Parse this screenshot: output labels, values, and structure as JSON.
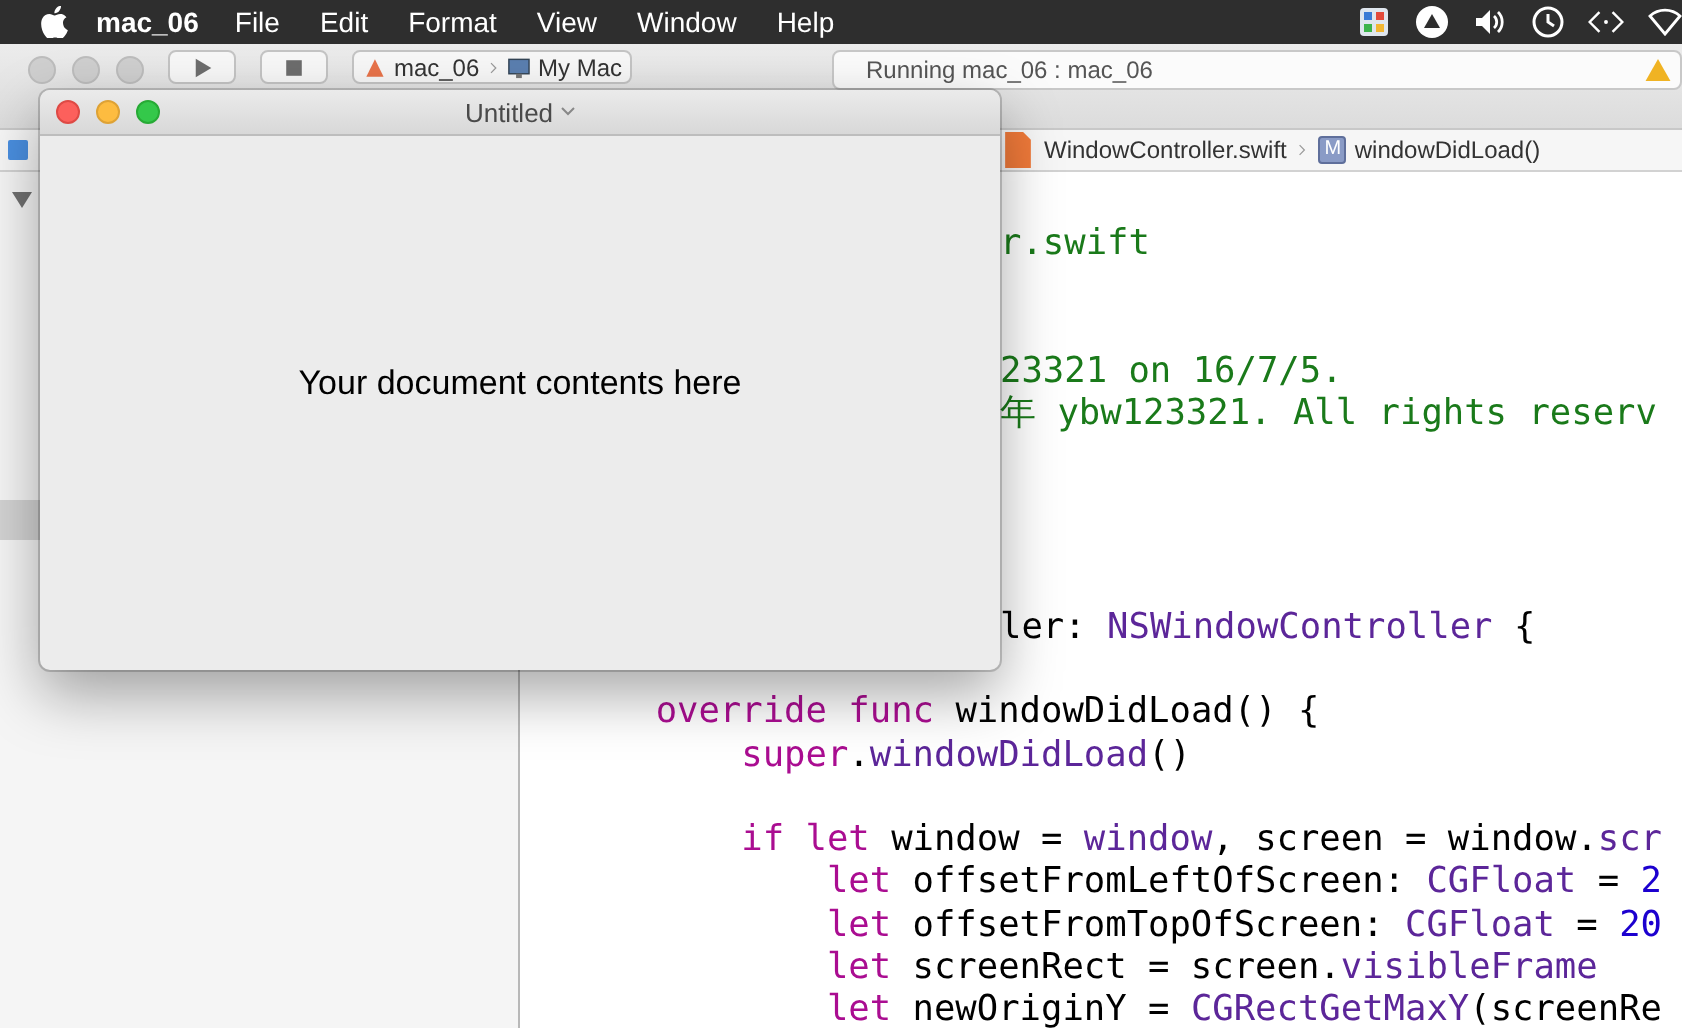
{
  "menu_bar": {
    "app": "mac_06",
    "items": [
      "File",
      "Edit",
      "Format",
      "View",
      "Window",
      "Help"
    ]
  },
  "xcode": {
    "toolbar": {
      "scheme": [
        "mac_06",
        "My Mac"
      ],
      "activity": "Running mac_06 : mac_06"
    },
    "jump_bar": [
      {
        "kind": "file",
        "label": "WindowController.swift"
      },
      {
        "kind": "method",
        "badge": "M",
        "label": "windowDidLoad()"
      }
    ],
    "editor": {
      "lines": [
        {
          "kind": "clipped",
          "segments": [
            {
              "kind": "comment",
              "text": "r.swift"
            }
          ]
        },
        {
          "kind": "blank"
        },
        {
          "kind": "blank"
        },
        {
          "kind": "clipped",
          "segments": [
            {
              "kind": "comment",
              "text": "23321 on 16/7/5."
            }
          ]
        },
        {
          "kind": "clipped",
          "segments": [
            {
              "kind": "comment",
              "text": "年 ybw123321. All rights reserv"
            }
          ]
        },
        {
          "kind": "blank"
        },
        {
          "kind": "blank"
        },
        {
          "kind": "blank"
        },
        {
          "kind": "blank"
        },
        {
          "kind": "clipped",
          "segments": [
            {
              "kind": "plain",
              "text": "ler: "
            },
            {
              "kind": "type",
              "text": "NSWindowController"
            },
            {
              "kind": "plain",
              "text": " {"
            }
          ],
          "children": [
            {
              "kind": "blank"
            },
            {
              "kind": "code",
              "segments": [
                {
                  "kind": "keyword",
                  "text": "override func"
                },
                {
                  "kind": "plain",
                  "text": " windowDidLoad() {"
                }
              ],
              "children": [
                {
                  "kind": "code",
                  "segments": [
                    {
                      "kind": "keyword",
                      "text": "super"
                    },
                    {
                      "kind": "plain",
                      "text": "."
                    },
                    {
                      "kind": "type",
                      "text": "windowDidLoad"
                    },
                    {
                      "kind": "plain",
                      "text": "()"
                    }
                  ]
                },
                {
                  "kind": "blank"
                },
                {
                  "kind": "code",
                  "segments": [
                    {
                      "kind": "keyword",
                      "text": "if let"
                    },
                    {
                      "kind": "plain",
                      "text": " window = "
                    },
                    {
                      "kind": "type",
                      "text": "window"
                    },
                    {
                      "kind": "plain",
                      "text": ", screen = window."
                    },
                    {
                      "kind": "type",
                      "text": "scr"
                    }
                  ],
                  "children": [
                    {
                      "kind": "code",
                      "segments": [
                        {
                          "kind": "keyword",
                          "text": "let"
                        },
                        {
                          "kind": "plain",
                          "text": " offsetFromLeftOfScreen: "
                        },
                        {
                          "kind": "type",
                          "text": "CGFloat"
                        },
                        {
                          "kind": "plain",
                          "text": " = "
                        },
                        {
                          "kind": "number",
                          "text": "2"
                        }
                      ]
                    },
                    {
                      "kind": "code",
                      "segments": [
                        {
                          "kind": "keyword",
                          "text": "let"
                        },
                        {
                          "kind": "plain",
                          "text": " offsetFromTopOfScreen: "
                        },
                        {
                          "kind": "type",
                          "text": "CGFloat"
                        },
                        {
                          "kind": "plain",
                          "text": " = "
                        },
                        {
                          "kind": "number",
                          "text": "20"
                        }
                      ]
                    },
                    {
                      "kind": "code",
                      "segments": [
                        {
                          "kind": "keyword",
                          "text": "let"
                        },
                        {
                          "kind": "plain",
                          "text": " screenRect = screen."
                        },
                        {
                          "kind": "type",
                          "text": "visibleFrame"
                        }
                      ]
                    },
                    {
                      "kind": "code",
                      "segments": [
                        {
                          "kind": "keyword",
                          "text": "let"
                        },
                        {
                          "kind": "plain",
                          "text": " newOriginY = "
                        },
                        {
                          "kind": "type",
                          "text": "CGRectGetMaxY"
                        },
                        {
                          "kind": "plain",
                          "text": "(screenRe"
                        }
                      ]
                    }
                  ]
                }
              ]
            }
          ]
        }
      ]
    }
  },
  "window": {
    "title": "Untitled",
    "content": "Your document contents here"
  }
}
